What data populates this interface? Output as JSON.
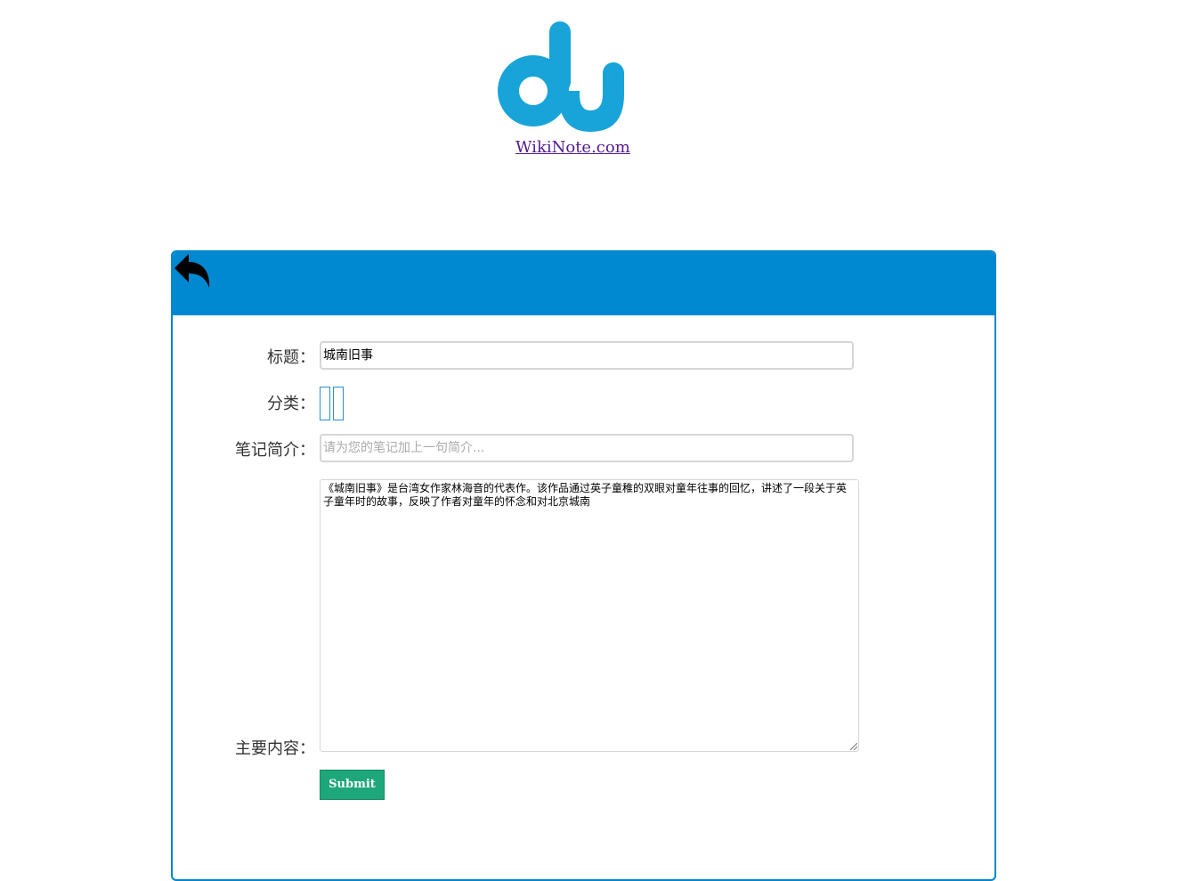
{
  "header": {
    "logo_icon": "du-logo-icon",
    "logo_color": "#18a4d8",
    "site_link": "WikiNote.com"
  },
  "panel": {
    "header_color": "#0088d0",
    "back_icon": "reply-arrow-icon",
    "form": {
      "title_label": "标题：",
      "title_value": "城南旧事",
      "category_label": "分类：",
      "summary_label": "笔记简介：",
      "summary_placeholder": "请为您的笔记加上一句简介...",
      "content_label": "主要内容：",
      "content_value": "《城南旧事》是台湾女作家林海音的代表作。该作品通过英子童稚的双眼对童年往事的回忆，讲述了一段关于英子童年时的故事，反映了作者对童年的怀念和对北京城南",
      "submit_label": "Submit",
      "submit_color": "#1ea77a"
    }
  }
}
